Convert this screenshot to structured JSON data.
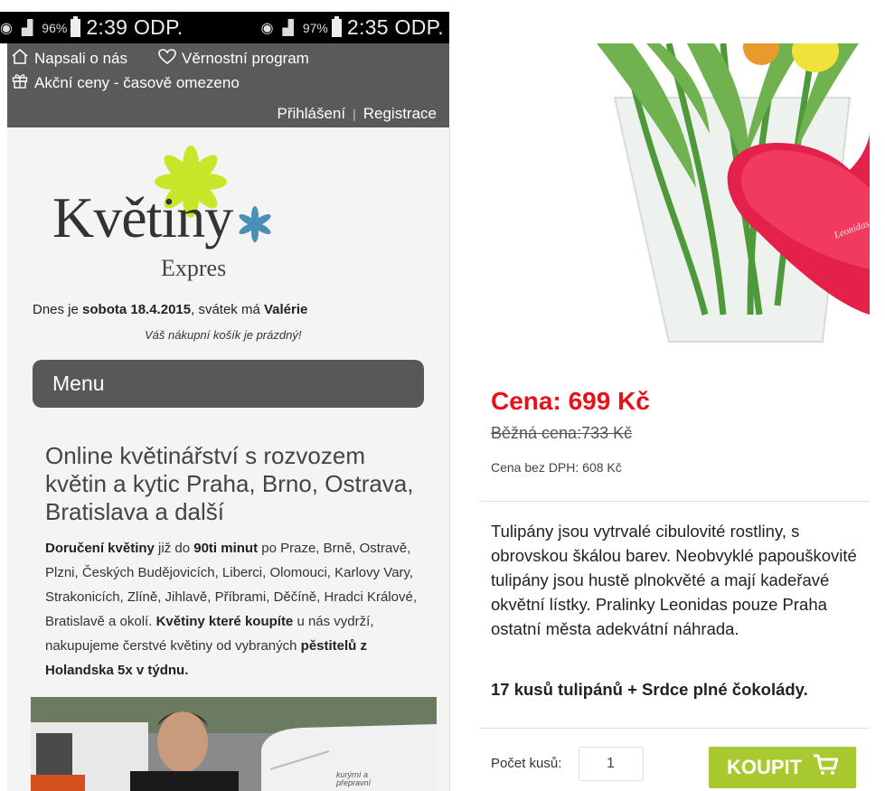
{
  "left_status": {
    "battery": "97%",
    "time": "2:35 ODP."
  },
  "right_status": {
    "battery": "96%",
    "time": "2:39 ODP."
  },
  "topnav": {
    "about_label": "Napsali o nás",
    "loyalty_label": "Věrnostní program",
    "sale_label": "Akční ceny - časově omezeno",
    "login_label": "Přihlášení",
    "separator": "|",
    "register_label": "Registrace"
  },
  "logo": {
    "word": "Květiny",
    "sub": "Expres"
  },
  "dateline": {
    "prefix": "Dnes je ",
    "date": "sobota 18.4.2015",
    "mid": ", svátek má ",
    "name": "Valérie"
  },
  "cart_status": "Váš nákupní košík je prázdný!",
  "menu_label": "Menu",
  "headline": "Online květinářství s rozvozem květin a kytic Praha, Brno, Ostrava, Bratislava a další",
  "paragraph": {
    "p1b": "Doručení květiny",
    "p2": " již do ",
    "p3b": "90ti minut",
    "p4": " po Praze, Brně, Ostravě, Plzni, Českých Budějovicích, Liberci, Olomouci, Karlovy Vary, Strakonicích, Zlíně, Jihlavě, Příbrami, Děčíně, Hradci Králové, Bratislavě a okolí. ",
    "p5b": "Květiny které koupíte",
    "p6": " u nás vydrží, nakupujeme čerstvé květiny od vybraných ",
    "p7b": "pěstitelů z Holandska 5x v týdnu."
  },
  "van_text": "kurýrní a přepravní",
  "product": {
    "price": "Cena: 699 Kč",
    "old_price": "Běžná cena:733 Kč",
    "vat_price": "Cena bez DPH: 608 Kč",
    "description": "Tulipány jsou vytrvalé cibulovité rostliny, s obrovskou škálou barev. Neobvyklé papouškovité tulipány jsou hustě plnokvěté a mají kadeřavé okvětní lístky. Pralinky Leonidas pouze Praha ostatní města adekvátní náhrada.",
    "tagline": "17 kusů tulipánů + Srdce plné čokolády.",
    "qty_label": "Počet kusů:",
    "qty_value": "1",
    "buy_label": "KOUPIT",
    "box_brand": "Leonidas"
  },
  "colors": {
    "nav_bg": "#5a5a5a",
    "price_red": "#e8101a",
    "buy_green": "#a8c92f",
    "logo_yellow": "#c8e62a",
    "logo_blue": "#4a8fb5"
  }
}
